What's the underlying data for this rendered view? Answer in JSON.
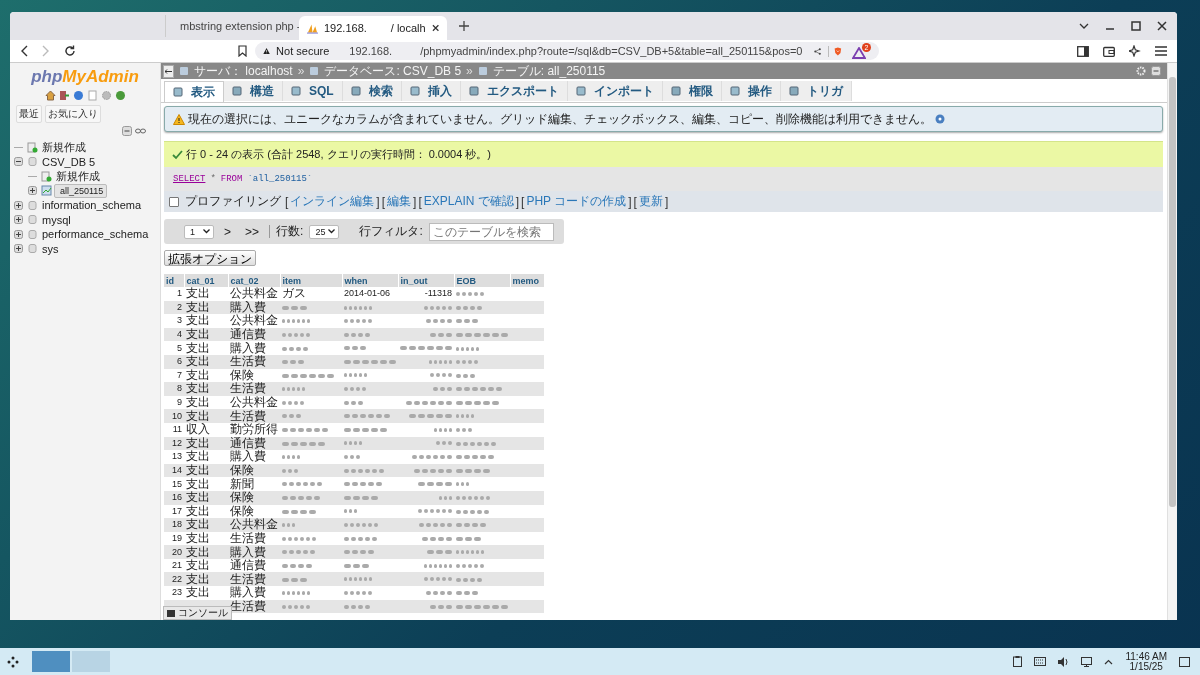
{
  "browser": {
    "tabs": [
      {
        "title": "mbstring extension php -",
        "selected": false
      },
      {
        "title": "192.168.",
        "title_2": "/ localh",
        "selected": true
      }
    ],
    "address": {
      "warning": "Not secure",
      "host": "192.168.",
      "path": "/phpmyadmin/index.php?route=/sql&db=CSV_DB+5&table=all_250115&pos=0"
    },
    "rewards_badge": "2"
  },
  "sidebar": {
    "logo": {
      "part_1": "php",
      "part_2": "MyAdmin"
    },
    "buttons": [
      "最近",
      "お気に入り"
    ],
    "tree": [
      {
        "label": "新規作成",
        "kind": "new",
        "selected": false
      },
      {
        "label": "CSV_DB 5",
        "kind": "db",
        "expanded": true,
        "selected": false,
        "children": [
          {
            "label": "新規作成",
            "kind": "new",
            "selected": false
          },
          {
            "label": "all_250115",
            "kind": "table",
            "expanded": false,
            "selected": true
          }
        ]
      },
      {
        "label": "information_schema",
        "kind": "db",
        "expanded": false,
        "selected": false
      },
      {
        "label": "mysql",
        "kind": "db",
        "expanded": false,
        "selected": false
      },
      {
        "label": "performance_schema",
        "kind": "db",
        "expanded": false,
        "selected": false
      },
      {
        "label": "sys",
        "kind": "db",
        "expanded": false,
        "selected": false
      }
    ]
  },
  "breadcrumb": [
    {
      "label": "サーバ：",
      "value": "localhost"
    },
    {
      "label": "データベース:",
      "value": "CSV_DB 5"
    },
    {
      "label": "テーブル:",
      "value": "all_250115"
    }
  ],
  "breadcrumb_separator": "»",
  "tabs": [
    {
      "label": "表示",
      "selected": true
    },
    {
      "label": "構造",
      "selected": false
    },
    {
      "label": "SQL",
      "selected": false
    },
    {
      "label": "検索",
      "selected": false
    },
    {
      "label": "挿入",
      "selected": false
    },
    {
      "label": "エクスポート",
      "selected": false
    },
    {
      "label": "インポート",
      "selected": false
    },
    {
      "label": "権限",
      "selected": false
    },
    {
      "label": "操作",
      "selected": false
    },
    {
      "label": "トリガ",
      "selected": false
    }
  ],
  "warning": "現在の選択には、ユニークなカラムが含まれていません。グリッド編集、チェックボックス、編集、コピー、削除機能は利用できません。",
  "success": "行 0 - 24 の表示 (合計 2548, クエリの実行時間： 0.0004 秒。)",
  "query": [
    {
      "kind": "keyword_link",
      "text": "SELECT"
    },
    {
      "kind": "operator",
      "text": "*"
    },
    {
      "kind": "keyword",
      "text": "FROM"
    },
    {
      "kind": "identifier",
      "text": "`all_250115`"
    }
  ],
  "profiling": {
    "label": "プロファイリング",
    "checked": false,
    "open_bracket": "[",
    "close_bracket": "]",
    "links": [
      "インライン編集",
      "編集",
      "EXPLAIN で確認",
      "PHP コードの作成",
      "更新"
    ]
  },
  "navigation": {
    "page": "1",
    "next": ">",
    "last": ">>",
    "rows_label": "行数:",
    "rows": "25",
    "filter_label": "行フィルタ:",
    "filter_placeholder": "このテーブルを検索"
  },
  "options_button": "拡張オプション",
  "table": {
    "columns": [
      "id",
      "cat_01",
      "cat_02",
      "item",
      "when",
      "in_out",
      "EOB",
      "memo"
    ],
    "rows": [
      {
        "cells": [
          "1",
          "支出",
          "公共料金",
          "ガス",
          "2014-01-06",
          "-11318",
          {
            "kind": "blurred"
          }
        ]
      },
      {
        "cells": [
          "2",
          "支出",
          "購入費",
          {
            "kind": "blurred"
          },
          {
            "kind": "blurred"
          },
          {
            "kind": "blurred"
          },
          {
            "kind": "blurred"
          }
        ]
      },
      {
        "cells": [
          "3",
          "支出",
          "公共料金",
          {
            "kind": "blurred"
          },
          {
            "kind": "blurred"
          },
          {
            "kind": "blurred"
          },
          {
            "kind": "blurred"
          }
        ]
      },
      {
        "cells": [
          "4",
          "支出",
          "通信費",
          {
            "kind": "blurred"
          },
          {
            "kind": "blurred"
          },
          {
            "kind": "blurred"
          },
          {
            "kind": "blurred"
          }
        ]
      },
      {
        "cells": [
          "5",
          "支出",
          "購入費",
          {
            "kind": "blurred"
          },
          {
            "kind": "blurred"
          },
          {
            "kind": "blurred"
          },
          {
            "kind": "blurred"
          }
        ]
      },
      {
        "cells": [
          "6",
          "支出",
          "生活費",
          {
            "kind": "blurred"
          },
          {
            "kind": "blurred"
          },
          {
            "kind": "blurred"
          },
          {
            "kind": "blurred"
          }
        ]
      },
      {
        "cells": [
          "7",
          "支出",
          "保険",
          {
            "kind": "blurred"
          },
          {
            "kind": "blurred"
          },
          {
            "kind": "blurred"
          },
          {
            "kind": "blurred"
          }
        ]
      },
      {
        "cells": [
          "8",
          "支出",
          "生活費",
          {
            "kind": "blurred"
          },
          {
            "kind": "blurred"
          },
          {
            "kind": "blurred"
          },
          {
            "kind": "blurred"
          }
        ]
      },
      {
        "cells": [
          "9",
          "支出",
          "公共料金",
          {
            "kind": "blurred"
          },
          {
            "kind": "blurred"
          },
          {
            "kind": "blurred"
          },
          {
            "kind": "blurred"
          }
        ]
      },
      {
        "cells": [
          "10",
          "支出",
          "生活費",
          {
            "kind": "blurred"
          },
          {
            "kind": "blurred"
          },
          {
            "kind": "blurred"
          },
          {
            "kind": "blurred"
          }
        ]
      },
      {
        "cells": [
          "11",
          "収入",
          "勤労所得",
          {
            "kind": "blurred"
          },
          {
            "kind": "blurred"
          },
          {
            "kind": "blurred"
          },
          {
            "kind": "blurred"
          }
        ]
      },
      {
        "cells": [
          "12",
          "支出",
          "通信費",
          {
            "kind": "blurred"
          },
          {
            "kind": "blurred"
          },
          {
            "kind": "blurred"
          },
          {
            "kind": "blurred"
          }
        ]
      },
      {
        "cells": [
          "13",
          "支出",
          "購入費",
          {
            "kind": "blurred"
          },
          {
            "kind": "blurred"
          },
          {
            "kind": "blurred"
          },
          {
            "kind": "blurred"
          }
        ]
      },
      {
        "cells": [
          "14",
          "支出",
          "保険",
          {
            "kind": "blurred"
          },
          {
            "kind": "blurred"
          },
          {
            "kind": "blurred"
          },
          {
            "kind": "blurred"
          }
        ]
      },
      {
        "cells": [
          "15",
          "支出",
          "新聞",
          {
            "kind": "blurred"
          },
          {
            "kind": "blurred"
          },
          {
            "kind": "blurred"
          },
          {
            "kind": "blurred"
          }
        ]
      },
      {
        "cells": [
          "16",
          "支出",
          "保険",
          {
            "kind": "blurred"
          },
          {
            "kind": "blurred"
          },
          {
            "kind": "blurred"
          },
          {
            "kind": "blurred"
          }
        ]
      },
      {
        "cells": [
          "17",
          "支出",
          "保険",
          {
            "kind": "blurred"
          },
          {
            "kind": "blurred"
          },
          {
            "kind": "blurred"
          },
          {
            "kind": "blurred"
          }
        ]
      },
      {
        "cells": [
          "18",
          "支出",
          "公共料金",
          {
            "kind": "blurred"
          },
          {
            "kind": "blurred"
          },
          {
            "kind": "blurred"
          },
          {
            "kind": "blurred"
          }
        ]
      },
      {
        "cells": [
          "19",
          "支出",
          "生活費",
          {
            "kind": "blurred"
          },
          {
            "kind": "blurred"
          },
          {
            "kind": "blurred"
          },
          {
            "kind": "blurred"
          }
        ]
      },
      {
        "cells": [
          "20",
          "支出",
          "購入費",
          {
            "kind": "blurred"
          },
          {
            "kind": "blurred"
          },
          {
            "kind": "blurred"
          },
          {
            "kind": "blurred"
          }
        ]
      },
      {
        "cells": [
          "21",
          "支出",
          "通信費",
          {
            "kind": "blurred"
          },
          {
            "kind": "blurred"
          },
          {
            "kind": "blurred"
          },
          {
            "kind": "blurred"
          }
        ]
      },
      {
        "cells": [
          "22",
          "支出",
          "生活費",
          {
            "kind": "blurred"
          },
          {
            "kind": "blurred"
          },
          {
            "kind": "blurred"
          },
          {
            "kind": "blurred"
          }
        ]
      },
      {
        "cells": [
          "23",
          "支出",
          "購入費",
          {
            "kind": "blurred"
          },
          {
            "kind": "blurred"
          },
          {
            "kind": "blurred"
          },
          {
            "kind": "blurred"
          }
        ]
      },
      {
        "cells": [
          {
            "kind": "covered"
          },
          {
            "kind": "covered"
          },
          "生活費",
          {
            "kind": "blurred"
          },
          {
            "kind": "blurred"
          },
          {
            "kind": "blurred"
          },
          {
            "kind": "blurred"
          }
        ]
      }
    ]
  },
  "console_button": "コンソール",
  "taskbar": {
    "time": "11:46 AM",
    "date": "1/15/25"
  }
}
